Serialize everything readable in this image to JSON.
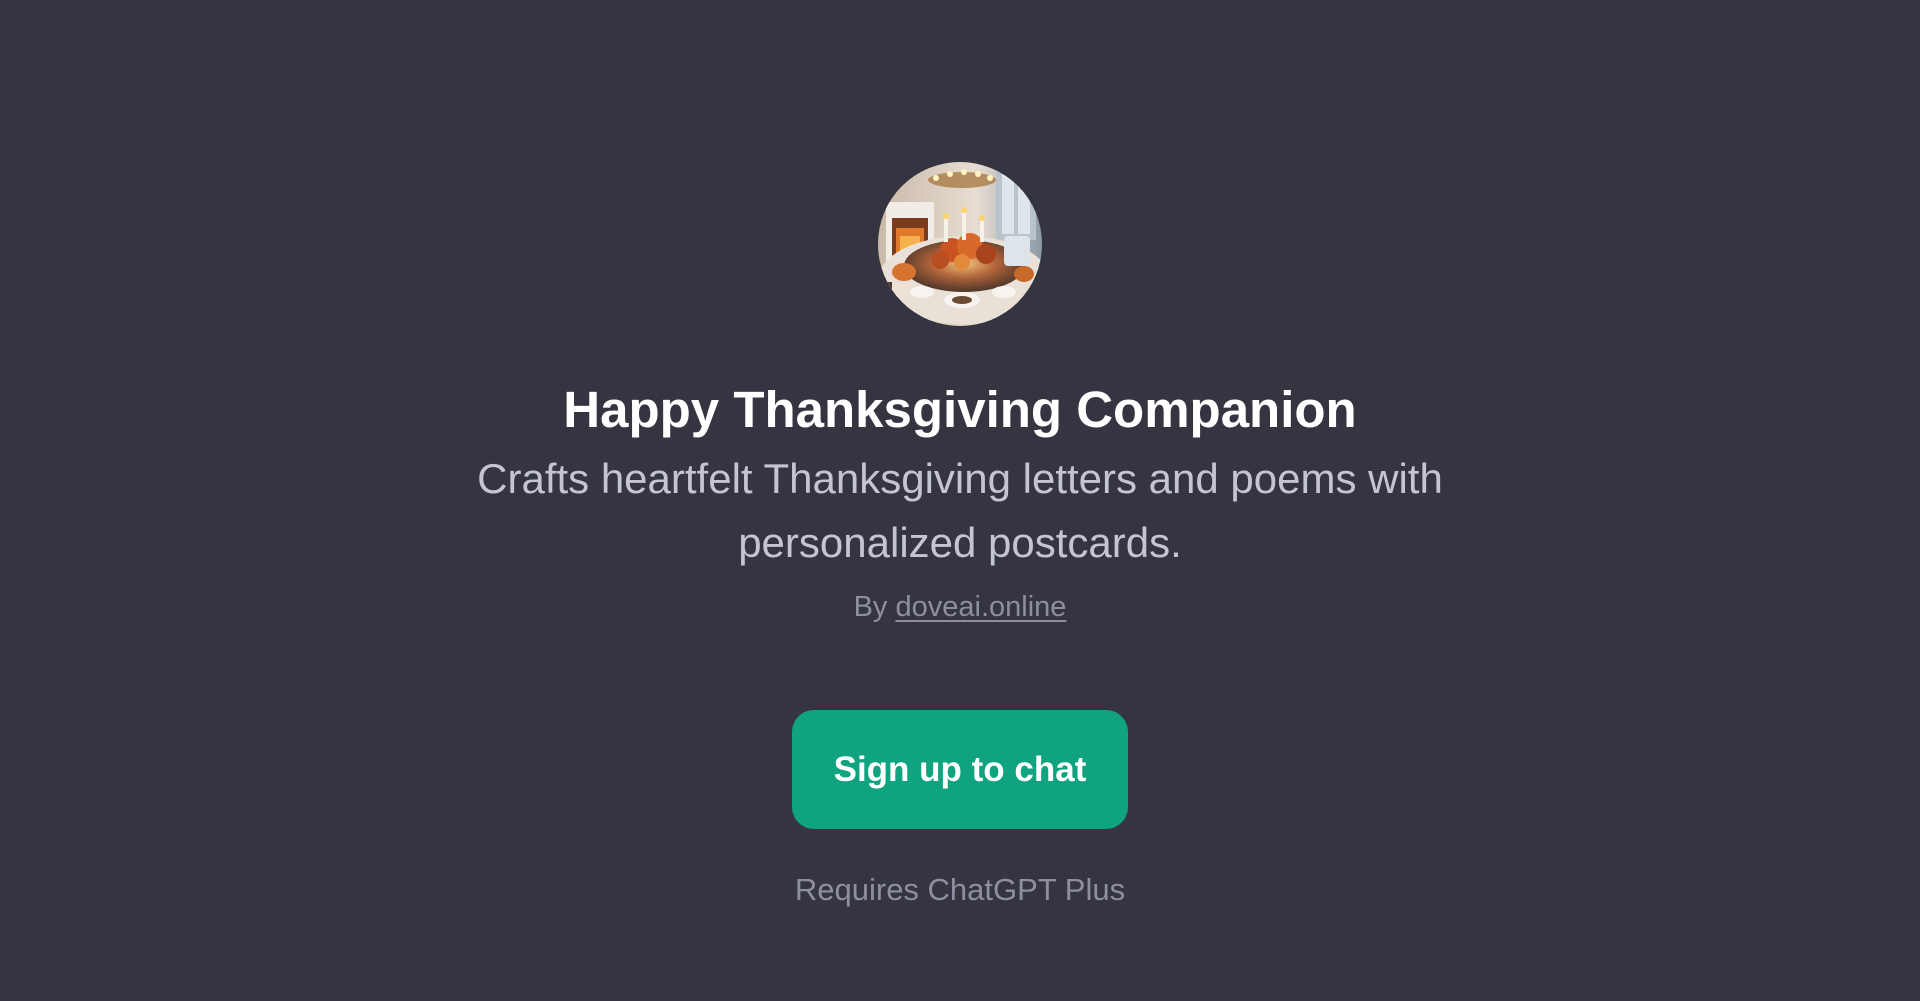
{
  "gpt": {
    "avatar_alt": "Happy Thanksgiving Companion",
    "title": "Happy Thanksgiving Companion",
    "description": "Crafts heartfelt Thanksgiving letters and poems with personalized postcards.",
    "author_prefix": "By",
    "author_link": "doveai.online"
  },
  "cta": {
    "label": "Sign up to chat"
  },
  "footer": {
    "requirement": "Requires ChatGPT Plus"
  },
  "colors": {
    "background": "#343541",
    "title": "#ffffff",
    "description": "#c5c5d2",
    "muted": "#8e8ea0",
    "accent": "#10a37f"
  }
}
